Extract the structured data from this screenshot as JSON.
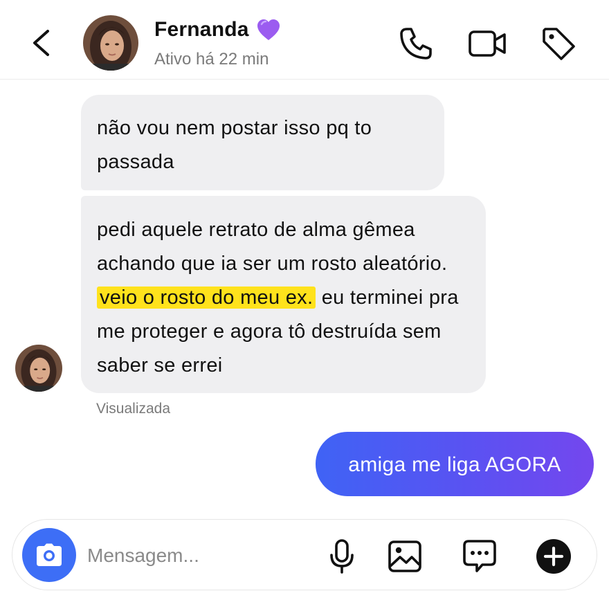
{
  "header": {
    "contact_name": "Fernanda",
    "status": "Ativo há 22 min"
  },
  "messages": [
    {
      "direction": "incoming",
      "text": "não vou nem postar isso pq to passada"
    },
    {
      "direction": "incoming",
      "text_before_highlight": "pedi aquele retrato de alma gêmea achando que ia ser um rosto aleatório. ",
      "highlight": "veio o rosto do meu ex.",
      "text_after_highlight": " eu terminei pra me proteger e agora tô destruída sem saber se errei"
    },
    {
      "direction": "outgoing",
      "text": "amiga me liga AGORA"
    }
  ],
  "seen_label": "Visualizada",
  "composer": {
    "placeholder": "Mensagem..."
  },
  "icons": {
    "back": "chevron-left-icon",
    "heart": "purple-heart-icon",
    "call": "phone-icon",
    "video": "video-camera-icon",
    "tag": "tag-icon",
    "camera": "camera-icon",
    "mic": "microphone-icon",
    "gallery": "image-icon",
    "chat": "chat-bubble-icon",
    "plus": "plus-circle-icon"
  },
  "colors": {
    "accent_blue": "#3d6ef6",
    "outgoing_gradient_start": "#3f63f5",
    "outgoing_gradient_end": "#7447ee",
    "incoming_bubble": "#efeff1",
    "highlight": "#ffe21c",
    "heart": "#9b5cf0"
  }
}
